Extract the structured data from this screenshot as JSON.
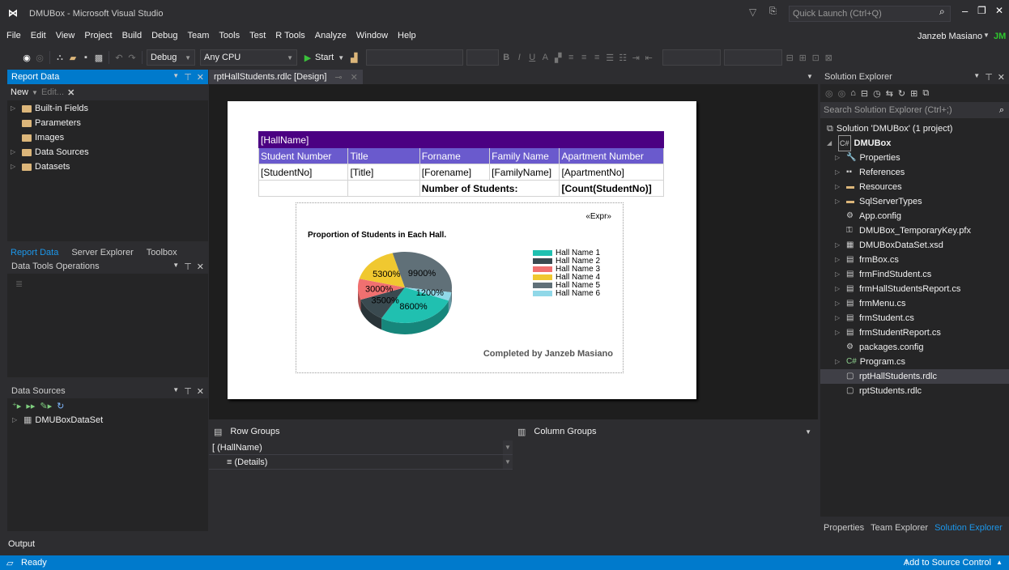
{
  "title": {
    "app": "DMUBox - Microsoft Visual Studio",
    "quick_launch": "Quick Launch (Ctrl+Q)"
  },
  "menu": [
    "File",
    "Edit",
    "View",
    "Project",
    "Build",
    "Debug",
    "Team",
    "Tools",
    "Test",
    "R Tools",
    "Analyze",
    "Window",
    "Help"
  ],
  "user": {
    "name": "Janzeb Masiano",
    "initials": "JM"
  },
  "toolbar": {
    "config": "Debug",
    "platform": "Any CPU",
    "start": "Start"
  },
  "report_data": {
    "title": "Report Data",
    "new_label": "New",
    "edit_label": "Edit...",
    "items": [
      {
        "label": "Built-in Fields",
        "expandable": true
      },
      {
        "label": "Parameters",
        "expandable": false
      },
      {
        "label": "Images",
        "expandable": false
      },
      {
        "label": "Data Sources",
        "expandable": true
      },
      {
        "label": "Datasets",
        "expandable": true
      }
    ],
    "tabs": [
      "Report Data",
      "Server Explorer",
      "Toolbox"
    ]
  },
  "data_tools": {
    "title": "Data Tools Operations"
  },
  "data_sources": {
    "title": "Data Sources",
    "item": "DMUBoxDataSet"
  },
  "doc_tab": "rptHallStudents.rdlc [Design]",
  "report": {
    "group_header": "[HallName]",
    "columns": [
      "Student Number",
      "Title",
      "Forname",
      "Family Name",
      "Apartment Number"
    ],
    "detail": [
      "[StudentNo]",
      "[Title]",
      "[Forename]",
      "[FamilyName]",
      "[ApartmentNo]"
    ],
    "total_label": "Number of Students:",
    "total_value": "[Count(StudentNo)]",
    "expr": "«Expr»",
    "footer": "Completed by Janzeb Masiano",
    "colors": {
      "header": "#4b0082",
      "columns": "#6a5acd"
    }
  },
  "chart_data": {
    "type": "pie",
    "title": "Proportion of Students in Each Hall.",
    "labels": [
      "Hall Name 1",
      "Hall Name 2",
      "Hall Name 3",
      "Hall Name 4",
      "Hall Name 5",
      "Hall Name 6"
    ],
    "values": [
      8600,
      3500,
      3000,
      5300,
      9900,
      1200
    ],
    "data_labels": [
      "8600%",
      "3500%",
      "3000%",
      "5300%",
      "9900%",
      "1200%"
    ],
    "colors": [
      "#20c0b0",
      "#3a4a50",
      "#f07070",
      "#f0c830",
      "#607078",
      "#90d8e8"
    ],
    "legend": "right"
  },
  "groups": {
    "row_title": "Row Groups",
    "col_title": "Column Groups",
    "rows": [
      "[ (HallName)",
      "≡ (Details)"
    ]
  },
  "solution_explorer": {
    "title": "Solution Explorer",
    "search_placeholder": "Search Solution Explorer (Ctrl+;)",
    "solution": "Solution 'DMUBox' (1 project)",
    "project": "DMUBox",
    "items": [
      {
        "label": "Properties",
        "expand": true,
        "icon": "wrench-icon"
      },
      {
        "label": "References",
        "expand": true,
        "icon": "references-icon"
      },
      {
        "label": "Resources",
        "expand": true,
        "icon": "folder-icon"
      },
      {
        "label": "SqlServerTypes",
        "expand": true,
        "icon": "folder-icon"
      },
      {
        "label": "App.config",
        "expand": false,
        "icon": "config-icon"
      },
      {
        "label": "DMUBox_TemporaryKey.pfx",
        "expand": false,
        "icon": "key-icon"
      },
      {
        "label": "DMUBoxDataSet.xsd",
        "expand": true,
        "icon": "dataset-icon"
      },
      {
        "label": "frmBox.cs",
        "expand": true,
        "icon": "form-icon"
      },
      {
        "label": "frmFindStudent.cs",
        "expand": true,
        "icon": "form-icon"
      },
      {
        "label": "frmHallStudentsReport.cs",
        "expand": true,
        "icon": "form-icon"
      },
      {
        "label": "frmMenu.cs",
        "expand": true,
        "icon": "form-icon"
      },
      {
        "label": "frmStudent.cs",
        "expand": true,
        "icon": "form-icon"
      },
      {
        "label": "frmStudentReport.cs",
        "expand": true,
        "icon": "form-icon"
      },
      {
        "label": "packages.config",
        "expand": false,
        "icon": "config-icon"
      },
      {
        "label": "Program.cs",
        "expand": true,
        "icon": "csharp-icon"
      },
      {
        "label": "rptHallStudents.rdlc",
        "expand": false,
        "icon": "report-icon",
        "selected": true
      },
      {
        "label": "rptStudents.rdlc",
        "expand": false,
        "icon": "report-icon"
      }
    ],
    "tabs": [
      "Properties",
      "Team Explorer",
      "Solution Explorer"
    ]
  },
  "output": {
    "title": "Output"
  },
  "status": {
    "ready": "Ready",
    "source_control": "Add to Source Control"
  }
}
